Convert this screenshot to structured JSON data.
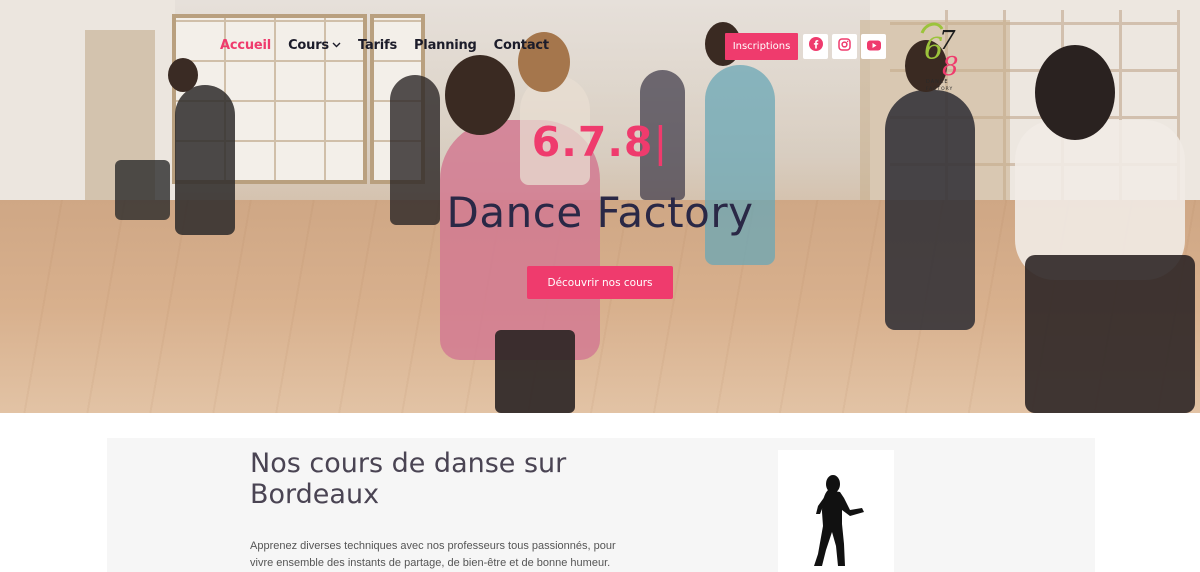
{
  "nav": {
    "items": [
      {
        "label": "Accueil",
        "active": true
      },
      {
        "label": "Cours",
        "active": false,
        "has_dropdown": true
      },
      {
        "label": "Tarifs",
        "active": false
      },
      {
        "label": "Planning",
        "active": false
      },
      {
        "label": "Contact",
        "active": false
      }
    ]
  },
  "header": {
    "inscriptions_label": "Inscriptions",
    "social": [
      {
        "icon": "facebook-icon",
        "color": "#ef3b6d"
      },
      {
        "icon": "instagram-icon",
        "color": "#ef3b6d"
      },
      {
        "icon": "youtube-icon",
        "color": "#ef3b6d"
      }
    ],
    "logo": {
      "text_top": "678",
      "text_bottom": "DANCE FACTORY"
    }
  },
  "hero": {
    "subtitle": "6.7.8",
    "cursor": "|",
    "title": "Dance Factory",
    "cta_label": "Découvrir nos cours"
  },
  "section": {
    "title": "Nos cours de danse sur Bordeaux",
    "text": "Apprenez diverses techniques avec nos professeurs tous passionnés, pour vivre ensemble des instants de partage, de bien-être et de bonne humeur."
  },
  "colors": {
    "accent": "#ef3b6d",
    "dark": "#2a2846"
  }
}
